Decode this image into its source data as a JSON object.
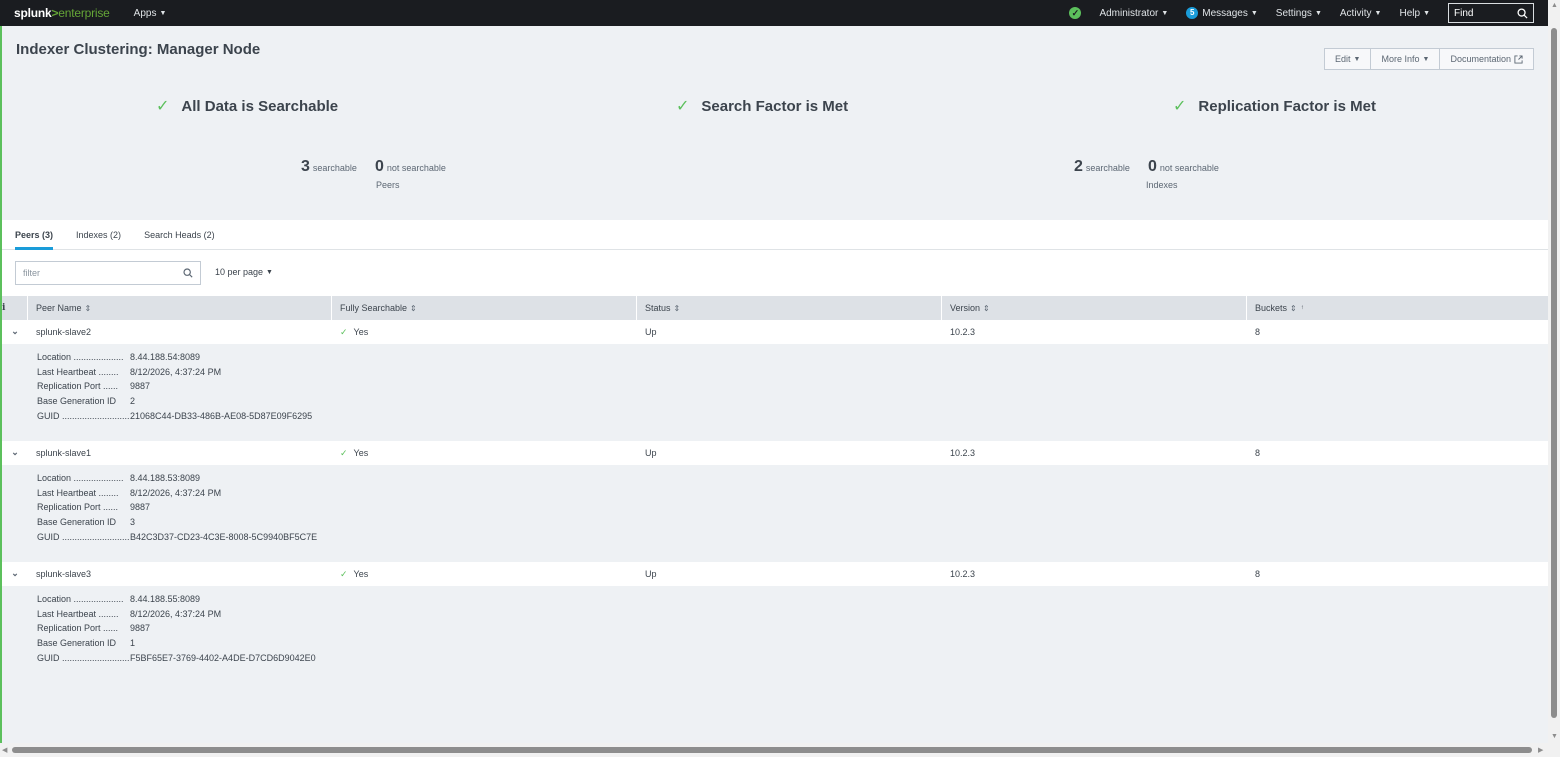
{
  "topbar": {
    "brand_main": "splunk",
    "brand_gt": ">",
    "brand_sub": "enterprise",
    "apps": "Apps",
    "health_icon": "check-circle-icon",
    "user": "Administrator",
    "messages_count": "5",
    "messages": "Messages",
    "settings": "Settings",
    "activity": "Activity",
    "help": "Help",
    "find_placeholder": "Find"
  },
  "header": {
    "title": "Indexer Clustering: Manager Node",
    "edit": "Edit",
    "more_info": "More Info",
    "documentation": "Documentation"
  },
  "status": {
    "searchable": "All Data is Searchable",
    "search_factor": "Search Factor is Met",
    "replication_factor": "Replication Factor is Met"
  },
  "peers_summary": {
    "searchable_count": "3",
    "searchable_label": "searchable",
    "not_searchable_count": "0",
    "not_searchable_label": "not searchable",
    "caption": "Peers"
  },
  "indexes_summary": {
    "searchable_count": "2",
    "searchable_label": "searchable",
    "not_searchable_count": "0",
    "not_searchable_label": "not searchable",
    "caption": "Indexes"
  },
  "tabs": [
    {
      "label": "Peers (3)"
    },
    {
      "label": "Indexes (2)"
    },
    {
      "label": "Search Heads (2)"
    }
  ],
  "filter": {
    "placeholder": "filter",
    "per_page": "10 per page"
  },
  "table": {
    "headers": {
      "info": "i",
      "peer_name": "Peer Name",
      "fully_searchable": "Fully Searchable",
      "status": "Status",
      "version": "Version",
      "buckets": "Buckets"
    },
    "detail_labels": {
      "location": "Location ....................",
      "heartbeat": "Last Heartbeat ........",
      "rep_port": "Replication Port ......",
      "base_gen": "Base Generation ID",
      "guid": "GUID ..........................."
    },
    "rows": [
      {
        "name": "splunk-slave2",
        "searchable": "Yes",
        "status": "Up",
        "version": "10.2.3",
        "buckets": "8",
        "location": "8.44.188.54:8089",
        "heartbeat": "8/12/2026, 4:37:24 PM",
        "rep_port": "9887",
        "base_gen": "2",
        "guid": "21068C44-DB33-486B-AE08-5D87E09F6295"
      },
      {
        "name": "splunk-slave1",
        "searchable": "Yes",
        "status": "Up",
        "version": "10.2.3",
        "buckets": "8",
        "location": "8.44.188.53:8089",
        "heartbeat": "8/12/2026, 4:37:24 PM",
        "rep_port": "9887",
        "base_gen": "3",
        "guid": "B42C3D37-CD23-4C3E-8008-5C9940BF5C7E"
      },
      {
        "name": "splunk-slave3",
        "searchable": "Yes",
        "status": "Up",
        "version": "10.2.3",
        "buckets": "8",
        "location": "8.44.188.55:8089",
        "heartbeat": "8/12/2026, 4:37:24 PM",
        "rep_port": "9887",
        "base_gen": "1",
        "guid": "F5BF65E7-3769-4402-A4DE-D7CD6D9042E0"
      }
    ]
  }
}
